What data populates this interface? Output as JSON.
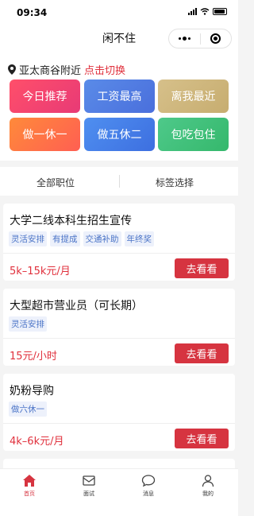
{
  "status_bar": {
    "time": "09:34"
  },
  "nav": {
    "title": "闲不住"
  },
  "location": {
    "text": "亚太商谷附近",
    "switch_label": "点击切换"
  },
  "quick_filters": [
    "今日推荐",
    "工资最高",
    "离我最近",
    "做一休一",
    "做五休二",
    "包吃包住"
  ],
  "filter_bar": {
    "all_positions": "全部职位",
    "tag_select": "标签选择"
  },
  "jobs": [
    {
      "title": "大学二线本科生招生宣传",
      "tags": [
        "灵活安排",
        "有提成",
        "交通补助",
        "年终奖"
      ],
      "salary": "5k–15k元/月",
      "button": "去看看"
    },
    {
      "title": "大型超市营业员（可长期）",
      "tags": [
        "灵活安排"
      ],
      "salary": "15元/小时",
      "button": "去看看"
    },
    {
      "title": "奶粉导购",
      "tags": [
        "做六休一"
      ],
      "salary": "4k–6k元/月",
      "button": "去看看"
    }
  ],
  "tabs": [
    {
      "label": "首页",
      "icon": "home-icon",
      "active": true
    },
    {
      "label": "面试",
      "icon": "mail-icon",
      "active": false
    },
    {
      "label": "消息",
      "icon": "chat-icon",
      "active": false
    },
    {
      "label": "我的",
      "icon": "user-icon",
      "active": false
    }
  ],
  "colors": {
    "accent": "#d63440",
    "tag_text": "#4b74c7",
    "tag_bg": "#edf1fb"
  }
}
